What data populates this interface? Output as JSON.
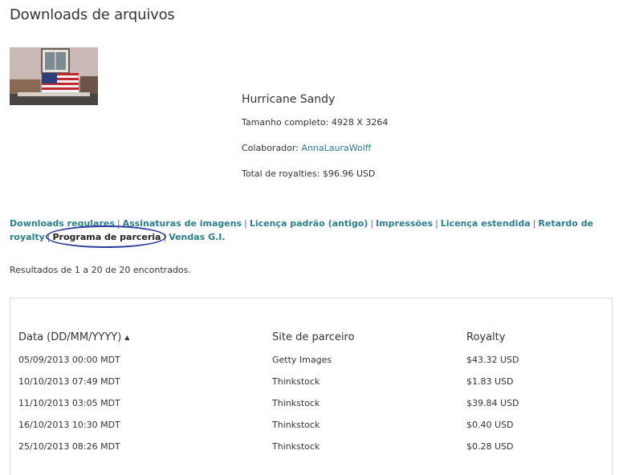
{
  "page": {
    "title": "Downloads de arquivos"
  },
  "image": {
    "name": "Hurricane Sandy",
    "size_label": "Tamanho completo:",
    "size_value": "4928 X 3264",
    "contributor_label": "Colaborador:",
    "contributor": "AnnaLauraWolff",
    "royalties_label": "Total de royalties:",
    "royalties_value": "$96.96 USD"
  },
  "tabs": [
    {
      "label": "Downloads regulares"
    },
    {
      "label": "Assinaturas de imagens"
    },
    {
      "label": "Licença padrão (antigo)"
    },
    {
      "label": "Impressões"
    },
    {
      "label": "Licença estendida"
    },
    {
      "label": "Retardo de royalty"
    },
    {
      "label": "Programa de parceria",
      "active": true
    },
    {
      "label": "Vendas G.I."
    }
  ],
  "results_text": "Resultados de 1 a 20 de 20 encontrados.",
  "table": {
    "headers": [
      "Data (DD/MM/YYYY)",
      "Site de parceiro",
      "Royalty"
    ],
    "rows": [
      [
        "05/09/2013 00:00 MDT",
        "Getty Images",
        "$43.32 USD"
      ],
      [
        "10/10/2013 07:49 MDT",
        "Thinkstock",
        "$1.83 USD"
      ],
      [
        "11/10/2013 03:05 MDT",
        "Thinkstock",
        "$39.84 USD"
      ],
      [
        "16/10/2013 10:30 MDT",
        "Thinkstock",
        "$0.40 USD"
      ],
      [
        "25/10/2013 08:26 MDT",
        "Thinkstock",
        "$0.28 USD"
      ]
    ]
  },
  "icons": {
    "sort": "sort-ascending-icon"
  },
  "colors": {
    "link": "#2a7f8d",
    "annotation_circle": "#2b3c9e"
  }
}
